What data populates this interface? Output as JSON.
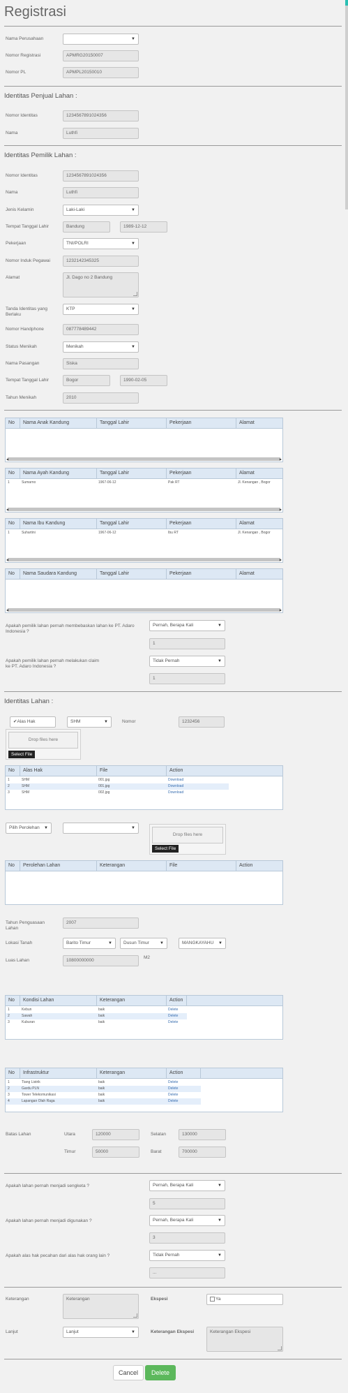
{
  "page": {
    "title": "Registrasi"
  },
  "company": {
    "nama_perusahaan_label": "Nama Perusahaan",
    "nama_perusahaan_value": "",
    "nomor_registrasi_label": "Nomor Registrasi",
    "nomor_registrasi_value": "APMRG20150007",
    "nomor_pl_label": "Nomor PL",
    "nomor_pl_value": "APMPL20150010"
  },
  "penjual": {
    "title": "Identitas Penjual Lahan :",
    "nomor_identitas_label": "Nomor Identitas",
    "nomor_identitas_value": "1234567891024356",
    "nama_label": "Nama",
    "nama_value": "Luthfi"
  },
  "pemilik": {
    "title": "Identitas Pemilik Lahan :",
    "nomor_identitas_label": "Nomor Identitas",
    "nomor_identitas_value": "1234567891024356",
    "nama_label": "Nama",
    "nama_value": "Luthfi",
    "jenis_kelamin_label": "Jenis Kelamin",
    "jenis_kelamin_value": "Laki-Laki",
    "ttl_label": "Tempat Tanggal Lahir",
    "tempat_lahir_value": "Bandung",
    "tanggal_lahir_value": "1989-12-12",
    "pekerjaan_label": "Pekerjaan",
    "pekerjaan_value": "TNI/POLRI",
    "nip_label": "Nomor Induk Pegawai",
    "nip_value": "1232142345325",
    "alamat_label": "Alamat",
    "alamat_value": "Jl. Dago no 2 Bandung",
    "tanda_identitas_label_1": "Tanda Identitas yang",
    "tanda_identitas_label_2": "Berlaku",
    "tanda_identitas_value": "KTP",
    "hp_label": "Nomor Handphone",
    "hp_value": "087778489442",
    "status_label": "Status Menikah",
    "status_value": "Menikah",
    "pasangan_label": "Nama Pasangan",
    "pasangan_value": "Siska",
    "ttl2_label": "Tempat Tanggal Lahir",
    "tempat_lahir2_value": "Bogor",
    "tanggal_lahir2_value": "1990-02-05",
    "tahun_menikah_label": "Tahun Menikah",
    "tahun_menikah_value": "2010"
  },
  "tables": {
    "anak": {
      "headers": [
        "No",
        "Nama Anak Kandung",
        "Tanggal Lahir",
        "Pekerjaan",
        "Alamat"
      ],
      "rows": []
    },
    "ayah": {
      "headers": [
        "No",
        "Nama Ayah Kandung",
        "Tanggal Lahir",
        "Pekerjaan",
        "Alamat"
      ],
      "rows": [
        [
          "1",
          "Sumarno",
          "1967-06-12",
          "Pak RT",
          "Jl. Kenangan , Bogor"
        ]
      ]
    },
    "ibu": {
      "headers": [
        "No",
        "Nama Ibu Kandung",
        "Tanggal Lahir",
        "Pekerjaan",
        "Alamat"
      ],
      "rows": [
        [
          "1",
          "Suhartini",
          "1967-06-12",
          "Ibu RT",
          "Jl. Kenangan , Bogor"
        ]
      ]
    },
    "saudara": {
      "headers": [
        "No",
        "Nama Saudara Kandung",
        "Tanggal Lahir",
        "Pekerjaan",
        "Alamat"
      ],
      "rows": []
    }
  },
  "adaro": {
    "q1_line1": "Apakah pemilik lahan pernah membebaskan lahan ke PT. Adaro",
    "q1_line2": "Indonesia ?",
    "q1_select": "Pernah, Berapa Kali",
    "q1_count": "1",
    "q2_line1": "Apakah pemilik lahan pernah melakukan claim",
    "q2_line2": "ke PT. Adaro Indonesia ?",
    "q2_select": "Tidak Pernah",
    "q2_count": "1"
  },
  "lahan": {
    "title": "Identitas Lahan :",
    "alas_hak_check": "Alas Hak",
    "alas_hak_select": "SHM",
    "nomor_label": "Nomor",
    "nomor_value": "1232456",
    "drop_text": "Drop files here",
    "select_file": "Select File",
    "alas_table": {
      "headers": [
        "No",
        "Alas Hak",
        "File",
        "Action"
      ],
      "rows": [
        [
          "1",
          "SHM",
          "001.jpg",
          "Download"
        ],
        [
          "2",
          "SHM",
          "001.jpg",
          "Download"
        ],
        [
          "3",
          "SHM",
          "002.jpg",
          "Download"
        ]
      ]
    },
    "perolehan_select": "Pilih Perolehan",
    "perolehan_select2": "",
    "drop_text2": "Drop files here",
    "select_file2": "Select File",
    "perolehan_table": {
      "headers": [
        "No",
        "Perolehan Lahan",
        "Keterangan",
        "File",
        "Action"
      ],
      "rows": []
    },
    "tahun_label_1": "Tahun Penguasaan",
    "tahun_label_2": "Lahan",
    "tahun_value": "2007",
    "lokasi_label": "Lokasi Tanah",
    "lokasi_1": "Barito Timur",
    "lokasi_2": "Dusun Timur",
    "lokasi_3": "MANGKAYAHU",
    "luas_label": "Luas Lahan",
    "luas_value": "10800000000",
    "luas_unit": "M2",
    "kondisi_table": {
      "headers": [
        "No",
        "Kondisi Lahan",
        "Keterangan",
        "Action"
      ],
      "rows": [
        [
          "1",
          "Kebun",
          "baik",
          "Delete"
        ],
        [
          "2",
          "Sawah",
          "baik",
          "Delete"
        ],
        [
          "3",
          "Kuburan",
          "baik",
          "Delete"
        ]
      ]
    },
    "infra_table": {
      "headers": [
        "No",
        "Infrastruktur",
        "Keterangan",
        "Action"
      ],
      "rows": [
        [
          "1",
          "Tiang Listrik",
          "baik",
          "Delete"
        ],
        [
          "2",
          "Gardu PLN",
          "baik",
          "Delete"
        ],
        [
          "3",
          "Tower Telekomunikasi",
          "baik",
          "Delete"
        ],
        [
          "4",
          "Lapangan Olah Raga",
          "baik",
          "Delete"
        ]
      ]
    },
    "batas_label": "Batas Lahan",
    "utara_label": "Utara",
    "utara_value": "120000",
    "selatan_label": "Selatan",
    "selatan_value": "130000",
    "timur_label": "Timur",
    "timur_value": "50000",
    "barat_label": "Barat",
    "barat_value": "700000"
  },
  "sengketa": {
    "q1": "Apakah lahan pernah menjadi sengketa ?",
    "q1_select": "Pernah, Berapa Kali",
    "q1_count": "5",
    "q2": "Apakah lahan pernah menjadi digunakan ?",
    "q2_select": "Pernah, Berapa Kali",
    "q2_count": "3",
    "q3": "Apakah alas hak pecahan dari alas hak orang lain ?",
    "q3_select": "Tidak Pernah",
    "q3_input": "..."
  },
  "footer": {
    "keterangan_label": "Keterangan",
    "keterangan_value": "Keterangan",
    "ekspesi_label": "Ekspesi",
    "ya_label": "Ya",
    "lanjut_label": "Lanjut",
    "lanjut_value": "Lanjut",
    "ket_ekspesi_label": "Keterangan Ekspesi",
    "ket_ekspesi_value": "Keterangan Ekspesi",
    "cancel": "Cancel",
    "delete": "Delete"
  },
  "colors": {
    "accent_green": "#5cb85c",
    "table_header": "#dde8f4",
    "scroll_accent": "#2abfb3"
  }
}
